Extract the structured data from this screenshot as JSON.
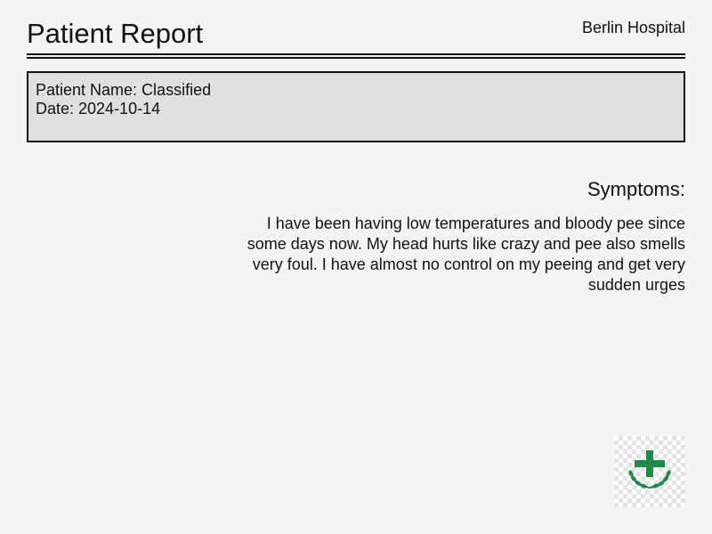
{
  "header": {
    "title": "Patient Report",
    "hospital": "Berlin Hospital"
  },
  "patient_info": {
    "name_line": "Patient Name: Classified",
    "date_line": "Date: 2024-10-14"
  },
  "symptoms": {
    "heading": "Symptoms:",
    "text": "I have been having low temperatures and bloody pee since some days now. My head hurts like crazy and pee also smells very foul. I have almost no control on my peeing and get very sudden urges"
  },
  "logo": {
    "icon": "medical-cross-laurel-icon",
    "color": "#1e8a46"
  }
}
